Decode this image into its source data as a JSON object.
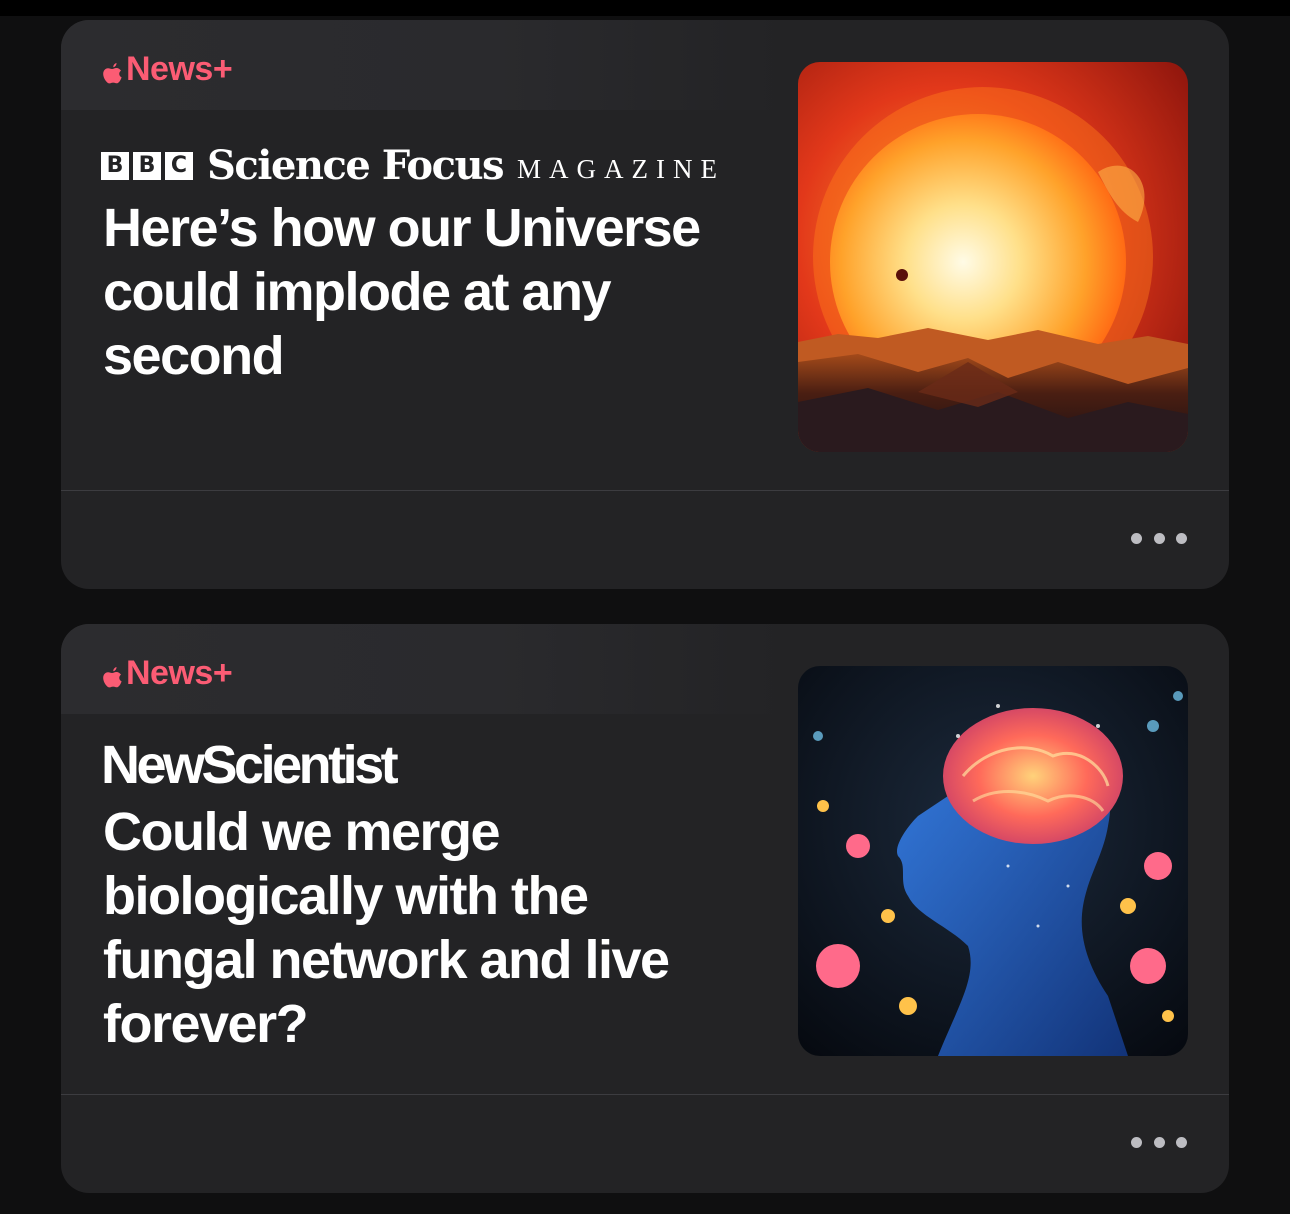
{
  "colors": {
    "background": "#0f0f10",
    "card": "#232325",
    "news_plus_accent": "#fb5c74",
    "text": "#ffffff",
    "more_dots": "#bdbdc2"
  },
  "articles": [
    {
      "badge_label": "News+",
      "badge_icon": "apple-logo-icon",
      "publisher": {
        "logo_letters": [
          "B",
          "B",
          "C"
        ],
        "title": "Science Focus",
        "suffix": "MAGAZINE"
      },
      "headline": "Here’s how our Universe could implode at any second",
      "thumbnail": "sun-over-alien-planet-image",
      "more_icon": "ellipsis-icon"
    },
    {
      "badge_label": "News+",
      "badge_icon": "apple-logo-icon",
      "publisher": {
        "title": "NewScientist"
      },
      "headline": "Could we merge biologically with the fungal network and live forever?",
      "thumbnail": "glowing-human-brain-among-flowers-image",
      "more_icon": "ellipsis-icon"
    }
  ]
}
